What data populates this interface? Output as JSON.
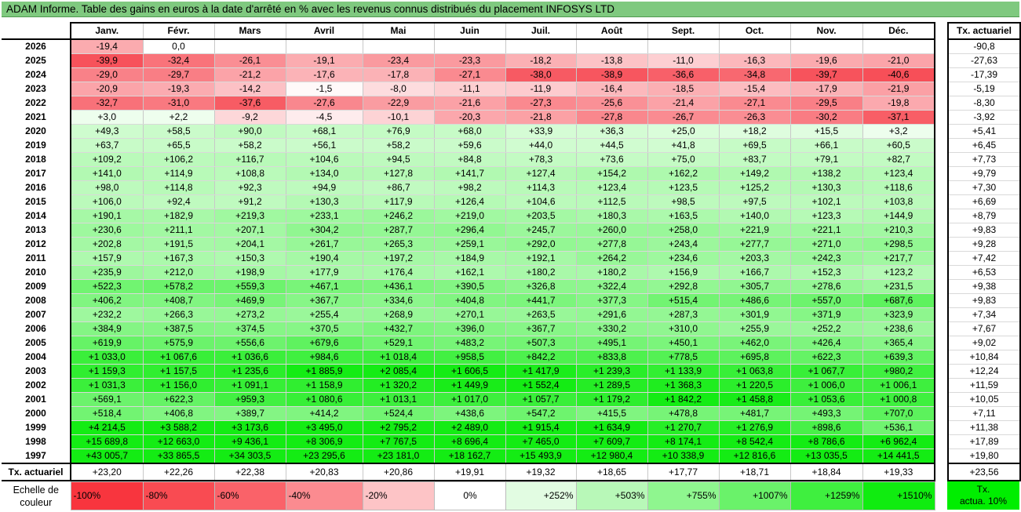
{
  "title": "ADAM Informe. Table des gains en euros à la date d'arrêté en % avec les revenus connus distribués du placement INFOSYS LTD",
  "months": [
    "Janv.",
    "Févr.",
    "Mars",
    "Avril",
    "Mai",
    "Juin",
    "Juil.",
    "Août",
    "Sept.",
    "Oct.",
    "Nov.",
    "Déc."
  ],
  "side_header": "Tx. actuariel",
  "rows": [
    {
      "year": "2026",
      "vals": [
        "-19,4",
        "0,0",
        "",
        "",
        "",
        "",
        "",
        "",
        "",
        "",
        "",
        ""
      ],
      "rate": "-90,8"
    },
    {
      "year": "2025",
      "vals": [
        "-39,9",
        "-32,4",
        "-26,1",
        "-19,1",
        "-23,4",
        "-23,3",
        "-18,2",
        "-13,8",
        "-11,0",
        "-16,3",
        "-19,6",
        "-21,0"
      ],
      "rate": "-27,63"
    },
    {
      "year": "2024",
      "vals": [
        "-29,0",
        "-29,7",
        "-21,2",
        "-17,6",
        "-17,8",
        "-27,1",
        "-38,0",
        "-38,9",
        "-36,6",
        "-34,8",
        "-39,7",
        "-40,6"
      ],
      "rate": "-17,39"
    },
    {
      "year": "2023",
      "vals": [
        "-20,9",
        "-19,3",
        "-14,2",
        "-1,5",
        "-8,0",
        "-11,1",
        "-11,9",
        "-16,4",
        "-18,5",
        "-15,4",
        "-17,9",
        "-21,9"
      ],
      "rate": "-5,19"
    },
    {
      "year": "2022",
      "vals": [
        "-32,7",
        "-31,0",
        "-37,6",
        "-27,6",
        "-22,9",
        "-21,6",
        "-27,3",
        "-25,6",
        "-21,4",
        "-27,1",
        "-29,5",
        "-19,8"
      ],
      "rate": "-8,30"
    },
    {
      "year": "2021",
      "vals": [
        "+3,0",
        "+2,2",
        "-9,2",
        "-4,5",
        "-10,1",
        "-20,3",
        "-21,8",
        "-27,8",
        "-26,7",
        "-26,3",
        "-30,2",
        "-37,1"
      ],
      "rate": "-3,92"
    },
    {
      "year": "2020",
      "vals": [
        "+49,3",
        "+58,5",
        "+90,0",
        "+68,1",
        "+76,9",
        "+68,0",
        "+33,9",
        "+36,3",
        "+25,0",
        "+18,2",
        "+15,5",
        "+3,2"
      ],
      "rate": "+5,41"
    },
    {
      "year": "2019",
      "vals": [
        "+63,7",
        "+65,5",
        "+58,2",
        "+56,1",
        "+58,2",
        "+59,6",
        "+44,0",
        "+44,5",
        "+41,8",
        "+69,5",
        "+66,1",
        "+60,5"
      ],
      "rate": "+6,45"
    },
    {
      "year": "2018",
      "vals": [
        "+109,2",
        "+106,2",
        "+116,7",
        "+104,6",
        "+94,5",
        "+84,8",
        "+78,3",
        "+73,6",
        "+75,0",
        "+83,7",
        "+79,1",
        "+82,7"
      ],
      "rate": "+7,73"
    },
    {
      "year": "2017",
      "vals": [
        "+141,0",
        "+114,9",
        "+108,8",
        "+134,0",
        "+127,8",
        "+141,7",
        "+127,4",
        "+154,2",
        "+162,2",
        "+149,2",
        "+138,2",
        "+123,4"
      ],
      "rate": "+9,79"
    },
    {
      "year": "2016",
      "vals": [
        "+98,0",
        "+114,8",
        "+92,3",
        "+94,9",
        "+86,7",
        "+98,2",
        "+114,3",
        "+123,4",
        "+123,5",
        "+125,2",
        "+130,3",
        "+118,6"
      ],
      "rate": "+7,30"
    },
    {
      "year": "2015",
      "vals": [
        "+106,0",
        "+92,4",
        "+91,2",
        "+130,3",
        "+117,9",
        "+126,4",
        "+104,6",
        "+112,5",
        "+98,5",
        "+97,5",
        "+102,1",
        "+103,8"
      ],
      "rate": "+6,69"
    },
    {
      "year": "2014",
      "vals": [
        "+190,1",
        "+182,9",
        "+219,3",
        "+233,1",
        "+246,2",
        "+219,0",
        "+203,5",
        "+180,3",
        "+163,5",
        "+140,0",
        "+123,3",
        "+144,9"
      ],
      "rate": "+8,79"
    },
    {
      "year": "2013",
      "vals": [
        "+230,6",
        "+211,1",
        "+207,1",
        "+304,2",
        "+287,7",
        "+296,4",
        "+245,7",
        "+260,0",
        "+258,0",
        "+221,9",
        "+221,1",
        "+210,3"
      ],
      "rate": "+9,83"
    },
    {
      "year": "2012",
      "vals": [
        "+202,8",
        "+191,5",
        "+204,1",
        "+261,7",
        "+265,3",
        "+259,1",
        "+292,0",
        "+277,8",
        "+243,4",
        "+277,7",
        "+271,0",
        "+298,5"
      ],
      "rate": "+9,28"
    },
    {
      "year": "2011",
      "vals": [
        "+157,9",
        "+167,3",
        "+150,3",
        "+190,4",
        "+197,2",
        "+184,9",
        "+192,1",
        "+264,2",
        "+234,6",
        "+203,3",
        "+242,3",
        "+217,7"
      ],
      "rate": "+7,42"
    },
    {
      "year": "2010",
      "vals": [
        "+235,9",
        "+212,0",
        "+198,9",
        "+177,9",
        "+176,4",
        "+162,1",
        "+180,2",
        "+180,2",
        "+156,9",
        "+166,7",
        "+152,3",
        "+123,2"
      ],
      "rate": "+6,53"
    },
    {
      "year": "2009",
      "vals": [
        "+522,3",
        "+578,2",
        "+559,3",
        "+467,1",
        "+436,1",
        "+390,5",
        "+326,8",
        "+322,4",
        "+292,8",
        "+305,7",
        "+278,6",
        "+231,5"
      ],
      "rate": "+9,38"
    },
    {
      "year": "2008",
      "vals": [
        "+406,2",
        "+408,7",
        "+469,9",
        "+367,7",
        "+334,6",
        "+404,8",
        "+441,7",
        "+377,3",
        "+515,4",
        "+486,6",
        "+557,0",
        "+687,6"
      ],
      "rate": "+9,83"
    },
    {
      "year": "2007",
      "vals": [
        "+232,2",
        "+266,3",
        "+273,2",
        "+255,4",
        "+268,9",
        "+270,1",
        "+263,5",
        "+291,6",
        "+287,3",
        "+301,9",
        "+371,9",
        "+323,9"
      ],
      "rate": "+7,34"
    },
    {
      "year": "2006",
      "vals": [
        "+384,9",
        "+387,5",
        "+374,5",
        "+370,5",
        "+432,7",
        "+396,0",
        "+367,7",
        "+330,2",
        "+310,0",
        "+255,9",
        "+252,2",
        "+238,6"
      ],
      "rate": "+7,67"
    },
    {
      "year": "2005",
      "vals": [
        "+619,9",
        "+575,9",
        "+556,6",
        "+679,6",
        "+529,1",
        "+483,2",
        "+507,3",
        "+495,1",
        "+450,1",
        "+462,0",
        "+426,4",
        "+365,4"
      ],
      "rate": "+9,02"
    },
    {
      "year": "2004",
      "vals": [
        "+1 033,0",
        "+1 067,6",
        "+1 036,6",
        "+984,6",
        "+1 018,4",
        "+958,5",
        "+842,2",
        "+833,8",
        "+778,5",
        "+695,8",
        "+622,3",
        "+639,3"
      ],
      "rate": "+10,84"
    },
    {
      "year": "2003",
      "vals": [
        "+1 159,3",
        "+1 157,5",
        "+1 235,6",
        "+1 885,9",
        "+2 085,4",
        "+1 606,5",
        "+1 417,9",
        "+1 239,3",
        "+1 133,9",
        "+1 063,8",
        "+1 067,7",
        "+980,2"
      ],
      "rate": "+12,24"
    },
    {
      "year": "2002",
      "vals": [
        "+1 031,3",
        "+1 156,0",
        "+1 091,1",
        "+1 158,9",
        "+1 320,2",
        "+1 449,9",
        "+1 552,4",
        "+1 289,5",
        "+1 368,3",
        "+1 220,5",
        "+1 006,0",
        "+1 006,1"
      ],
      "rate": "+11,59"
    },
    {
      "year": "2001",
      "vals": [
        "+569,1",
        "+622,3",
        "+959,3",
        "+1 080,6",
        "+1 013,1",
        "+1 017,0",
        "+1 057,7",
        "+1 179,2",
        "+1 842,2",
        "+1 458,8",
        "+1 053,6",
        "+1 000,8"
      ],
      "rate": "+10,05"
    },
    {
      "year": "2000",
      "vals": [
        "+518,4",
        "+406,8",
        "+389,7",
        "+414,2",
        "+524,4",
        "+438,6",
        "+547,2",
        "+415,5",
        "+478,8",
        "+481,7",
        "+493,3",
        "+707,0"
      ],
      "rate": "+7,11"
    },
    {
      "year": "1999",
      "vals": [
        "+4 214,5",
        "+3 588,2",
        "+3 173,6",
        "+3 495,0",
        "+2 795,2",
        "+2 489,0",
        "+1 915,4",
        "+1 634,9",
        "+1 270,7",
        "+1 276,9",
        "+898,6",
        "+536,1"
      ],
      "rate": "+11,38"
    },
    {
      "year": "1998",
      "vals": [
        "+15 689,8",
        "+12 663,0",
        "+9 436,1",
        "+8 306,9",
        "+7 767,5",
        "+8 696,4",
        "+7 465,0",
        "+7 609,7",
        "+8 174,1",
        "+8 542,4",
        "+8 786,6",
        "+6 962,4"
      ],
      "rate": "+17,89"
    },
    {
      "year": "1997",
      "vals": [
        "+43 005,7",
        "+33 865,5",
        "+34 303,5",
        "+23 295,6",
        "+23 181,0",
        "+18 162,7",
        "+15 493,9",
        "+12 980,4",
        "+10 338,9",
        "+12 816,6",
        "+13 035,5",
        "+14 441,5"
      ],
      "rate": "+19,80"
    }
  ],
  "totals": {
    "label": "Tx. actuariel",
    "vals": [
      "+23,20",
      "+22,26",
      "+22,38",
      "+20,83",
      "+20,86",
      "+19,91",
      "+19,32",
      "+18,65",
      "+17,77",
      "+18,71",
      "+18,84",
      "+19,33"
    ],
    "rate": "+23,56"
  },
  "scale": {
    "label": "Echelle de couleur",
    "items": [
      {
        "text": "-100%",
        "color": "#f8353e",
        "kind": "neg"
      },
      {
        "text": "-80%",
        "color": "#f94b52",
        "kind": "neg"
      },
      {
        "text": "-60%",
        "color": "#fa6269",
        "kind": "neg"
      },
      {
        "text": "-40%",
        "color": "#fb8b90",
        "kind": "neg"
      },
      {
        "text": "-20%",
        "color": "#fdc4c6",
        "kind": "neg"
      },
      {
        "text": "0%",
        "color": "#ffffff",
        "kind": "zero"
      },
      {
        "text": "+252%",
        "color": "#e2fce2",
        "kind": "pos"
      },
      {
        "text": "+503%",
        "color": "#b8f8b8",
        "kind": "pos"
      },
      {
        "text": "+755%",
        "color": "#8ff68f",
        "kind": "pos"
      },
      {
        "text": "+1007%",
        "color": "#6af26a",
        "kind": "pos"
      },
      {
        "text": "+1259%",
        "color": "#3fef3f",
        "kind": "pos"
      },
      {
        "text": "+1510%",
        "color": "#10ec10",
        "kind": "pos"
      }
    ],
    "side": "Tx.\nactua. 10%",
    "side_color": "#00ee00"
  }
}
